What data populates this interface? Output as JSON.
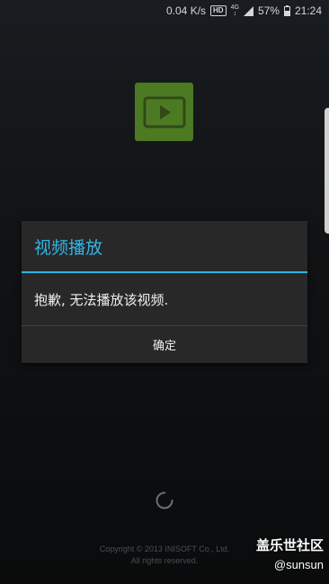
{
  "status_bar": {
    "net_speed": "0.04 K/s",
    "hd_label": "HD",
    "net_type_top": "4G",
    "net_type_bottom": "↕",
    "battery": "57%",
    "time": "21:24"
  },
  "app": {
    "icon": "video-play-icon",
    "icon_color": "#4c7a22"
  },
  "dialog": {
    "title": "视频播放",
    "message": "抱歉, 无法播放该视频.",
    "ok_label": "确定",
    "accent_color": "#33b5e5"
  },
  "footer": {
    "copyright": "Copyright © 2013 INISOFT Co., Ltd.",
    "rights": "All rights reserved."
  },
  "watermark": {
    "site": "盖乐世社区",
    "user": "@sunsun"
  }
}
